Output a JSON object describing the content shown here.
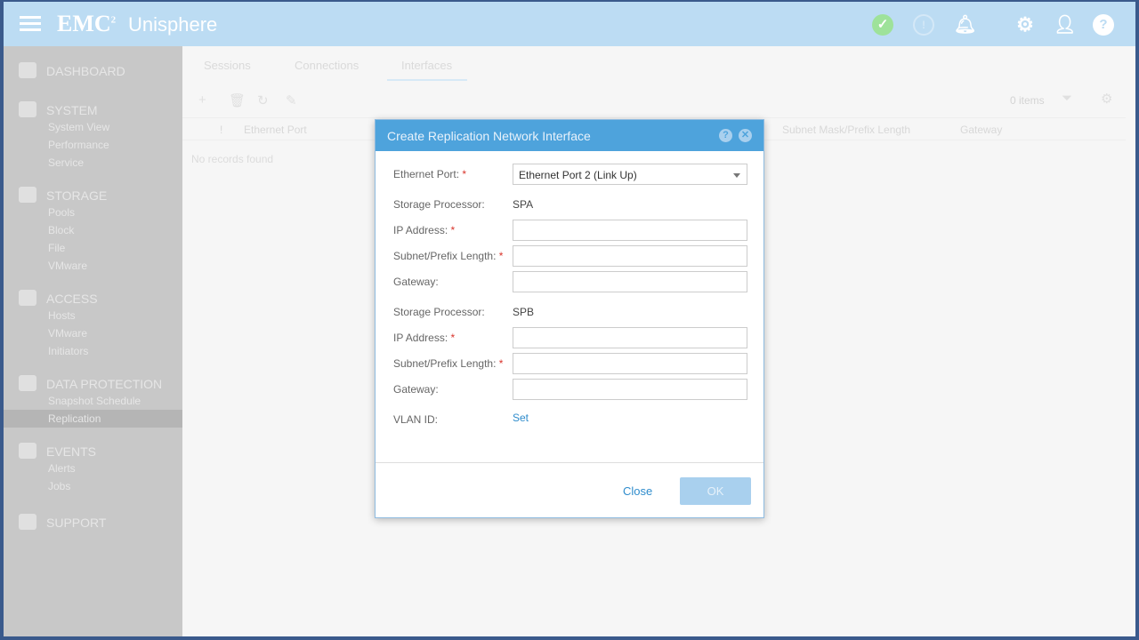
{
  "header": {
    "logo": "EMC",
    "logo_sup": "2",
    "title": "Unisphere"
  },
  "sidebar": {
    "sections": [
      {
        "label": "DASHBOARD",
        "items": []
      },
      {
        "label": "SYSTEM",
        "items": [
          "System View",
          "Performance",
          "Service"
        ]
      },
      {
        "label": "STORAGE",
        "items": [
          "Pools",
          "Block",
          "File",
          "VMware"
        ]
      },
      {
        "label": "ACCESS",
        "items": [
          "Hosts",
          "VMware",
          "Initiators"
        ]
      },
      {
        "label": "DATA PROTECTION",
        "items": [
          "Snapshot Schedule",
          "Replication"
        ]
      },
      {
        "label": "EVENTS",
        "items": [
          "Alerts",
          "Jobs"
        ]
      },
      {
        "label": "SUPPORT",
        "items": []
      }
    ],
    "selected": "Replication"
  },
  "main": {
    "tabs": [
      "Sessions",
      "Connections",
      "Interfaces"
    ],
    "active_tab": "Interfaces",
    "items_count": "0 items",
    "columns": [
      "!",
      "Ethernet Port",
      "Subnet Mask/Prefix Length",
      "Gateway"
    ],
    "empty": "No records found"
  },
  "dialog": {
    "title": "Create Replication Network Interface",
    "ethernet_port_label": "Ethernet Port:",
    "ethernet_port_value": "Ethernet Port 2 (Link Up)",
    "sp_label": "Storage Processor:",
    "spa": "SPA",
    "spb": "SPB",
    "ip_label": "IP Address:",
    "subnet_label": "Subnet/Prefix Length:",
    "gateway_label": "Gateway:",
    "vlan_label": "VLAN ID:",
    "vlan_link": "Set",
    "req": "*",
    "close": "Close",
    "ok": "OK"
  },
  "colors": {
    "header": "#bcdcf3",
    "dialog_header": "#4ea3dc",
    "link": "#2f8ccc",
    "required": "#d9342b"
  }
}
